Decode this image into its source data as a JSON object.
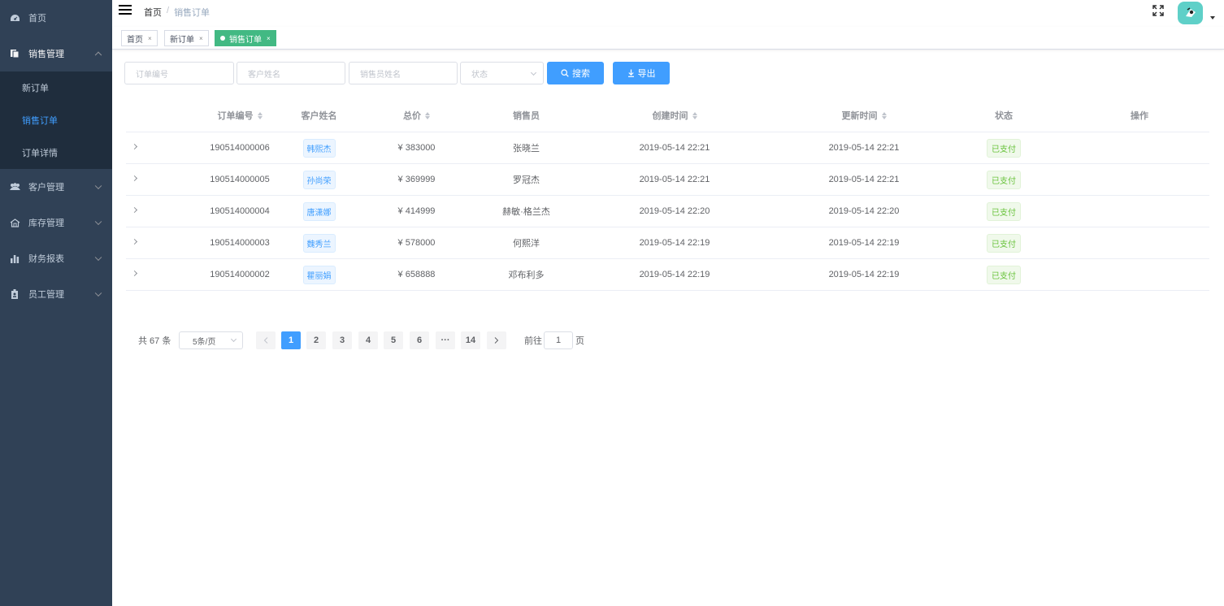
{
  "sidebar": {
    "home": "首页",
    "sales": "销售管理",
    "sales_children": [
      "新订单",
      "销售订单",
      "订单详情"
    ],
    "customers": "客户管理",
    "inventory": "库存管理",
    "finance": "财务报表",
    "staff": "员工管理"
  },
  "navbar": {
    "breadcrumb_home": "首页",
    "breadcrumb_sep": "/",
    "breadcrumb_current": "销售订单"
  },
  "tags": [
    {
      "label": "首页",
      "close": "×"
    },
    {
      "label": "新订单",
      "close": "×"
    },
    {
      "label": "销售订单",
      "close": "×"
    }
  ],
  "filters": {
    "order_no_placeholder": "订单编号",
    "customer_placeholder": "客户姓名",
    "seller_placeholder": "销售员姓名",
    "status_placeholder": "状态",
    "search_label": "搜索",
    "export_label": "导出"
  },
  "table": {
    "headers": [
      "订单编号",
      "客户姓名",
      "总价",
      "销售员",
      "创建时间",
      "更新时间",
      "状态",
      "操作"
    ],
    "rows": [
      {
        "order_no": "190514000006",
        "customer": "韩熙杰",
        "price": "¥ 383000",
        "seller": "张晓兰",
        "created": "2019-05-14 22:21",
        "updated": "2019-05-14 22:21",
        "status": "已支付"
      },
      {
        "order_no": "190514000005",
        "customer": "孙尚荣",
        "price": "¥ 369999",
        "seller": "罗冠杰",
        "created": "2019-05-14 22:21",
        "updated": "2019-05-14 22:21",
        "status": "已支付"
      },
      {
        "order_no": "190514000004",
        "customer": "唐潇娜",
        "price": "¥ 414999",
        "seller": "赫敏·格兰杰",
        "created": "2019-05-14 22:20",
        "updated": "2019-05-14 22:20",
        "status": "已支付"
      },
      {
        "order_no": "190514000003",
        "customer": "魏秀兰",
        "price": "¥ 578000",
        "seller": "何熙洋",
        "created": "2019-05-14 22:19",
        "updated": "2019-05-14 22:19",
        "status": "已支付"
      },
      {
        "order_no": "190514000002",
        "customer": "瞿丽娟",
        "price": "¥ 658888",
        "seller": "邓布利多",
        "created": "2019-05-14 22:19",
        "updated": "2019-05-14 22:19",
        "status": "已支付"
      }
    ]
  },
  "pagination": {
    "total": "共 67 条",
    "page_size": "5条/页",
    "pages": [
      "1",
      "2",
      "3",
      "4",
      "5",
      "6",
      "···",
      "14"
    ],
    "current": "1",
    "goto_label": "前往",
    "goto_value": "1",
    "page_suffix": "页"
  },
  "colors": {
    "sidebar_bg": "#304156",
    "submenu_bg": "#1f2d3d",
    "primary": "#409eff",
    "tag_active": "#42b983",
    "success": "#67c23a"
  }
}
